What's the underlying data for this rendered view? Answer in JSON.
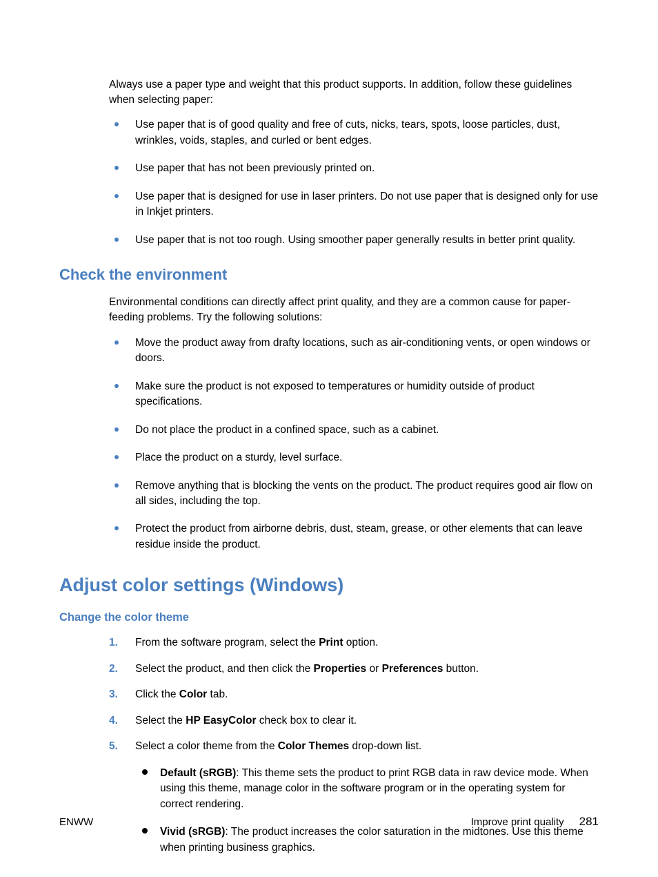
{
  "intro1": "Always use a paper type and weight that this product supports. In addition, follow these guidelines when selecting paper:",
  "bullets1": [
    "Use paper that is of good quality and free of cuts, nicks, tears, spots, loose particles, dust, wrinkles, voids, staples, and curled or bent edges.",
    "Use paper that has not been previously printed on.",
    "Use paper that is designed for use in laser printers. Do not use paper that is designed only for use in Inkjet printers.",
    "Use paper that is not too rough. Using smoother paper generally results in better print quality."
  ],
  "h_env": "Check the environment",
  "intro2": "Environmental conditions can directly affect print quality, and they are a common cause for paper-feeding problems. Try the following solutions:",
  "bullets2": [
    "Move the product away from drafty locations, such as air-conditioning vents, or open windows or doors.",
    "Make sure the product is not exposed to temperatures or humidity outside of product specifications.",
    "Do not place the product in a confined space, such as a cabinet.",
    "Place the product on a sturdy, level surface.",
    "Remove anything that is blocking the vents on the product. The product requires good air flow on all sides, including the top.",
    "Protect the product from airborne debris, dust, steam, grease, or other elements that can leave residue inside the product."
  ],
  "h_adjust": "Adjust color settings (Windows)",
  "h_change": "Change the color theme",
  "steps": {
    "s1_a": "From the software program, select the ",
    "s1_b": "Print",
    "s1_c": " option.",
    "s2_a": "Select the product, and then click the ",
    "s2_b": "Properties",
    "s2_c": " or ",
    "s2_d": "Preferences",
    "s2_e": " button.",
    "s3_a": "Click the ",
    "s3_b": "Color",
    "s3_c": " tab.",
    "s4_a": "Select the ",
    "s4_b": "HP EasyColor",
    "s4_c": " check box to clear it.",
    "s5_a": "Select a color theme from the ",
    "s5_b": "Color Themes",
    "s5_c": " drop-down list."
  },
  "sub": {
    "d_b": "Default (sRGB)",
    "d_t": ": This theme sets the product to print RGB data in raw device mode. When using this theme, manage color in the software program or in the operating system for correct rendering.",
    "v_b": "Vivid (sRGB)",
    "v_t": ": The product increases the color saturation in the midtones. Use this theme when printing business graphics."
  },
  "footer_left": "ENWW",
  "footer_right": "Improve print quality",
  "page_number": "281"
}
